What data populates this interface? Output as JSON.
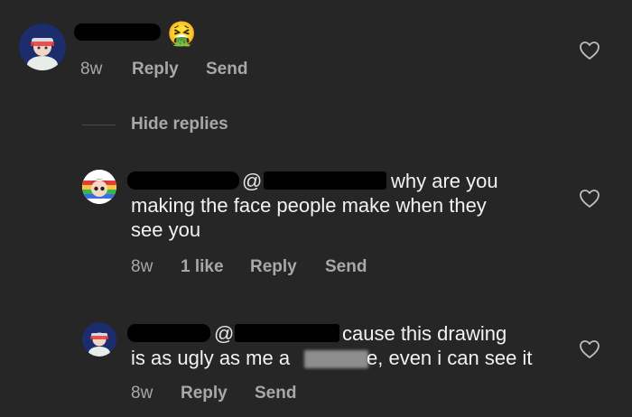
{
  "comment_main": {
    "emoji": "🤮",
    "time": "8w",
    "reply_label": "Reply",
    "send_label": "Send"
  },
  "hide_replies": "Hide replies",
  "reply_1": {
    "mention_prefix": "@",
    "line1": "why are you",
    "line2": "making the face people make when they",
    "line3": "see you",
    "time": "8w",
    "likes": "1 like",
    "reply_label": "Reply",
    "send_label": "Send"
  },
  "reply_2": {
    "mention_prefix": "@",
    "line1": "cause this drawing",
    "line2_start": "is as ugly as me a",
    "line2_end": "e, even i can see it",
    "time": "8w",
    "reply_label": "Reply",
    "send_label": "Send"
  },
  "icons": {
    "like": "heart-outline-icon",
    "vomit": "face-vomiting-emoji"
  },
  "colors": {
    "background": "#262626",
    "text_primary": "#f2f2f2",
    "text_secondary": "#a8a8a8"
  }
}
